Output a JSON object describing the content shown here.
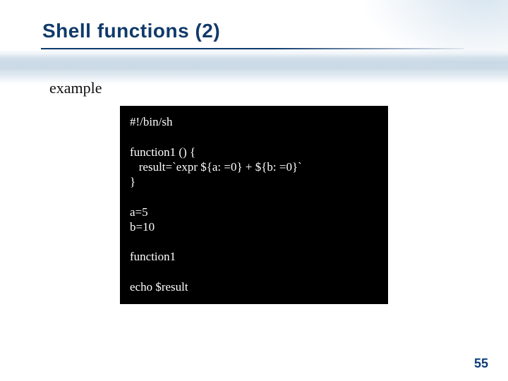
{
  "title": "Shell functions (2)",
  "subtitle": "example",
  "code": {
    "shebang": "#!/bin/sh",
    "func_open": "function1 () {",
    "func_body": "   result=`expr ${a: =0} + ${b: =0}`",
    "func_close": "}",
    "assign_a": "a=5",
    "assign_b": "b=10",
    "call": "function1",
    "echo": "echo $result"
  },
  "page_number": "55"
}
